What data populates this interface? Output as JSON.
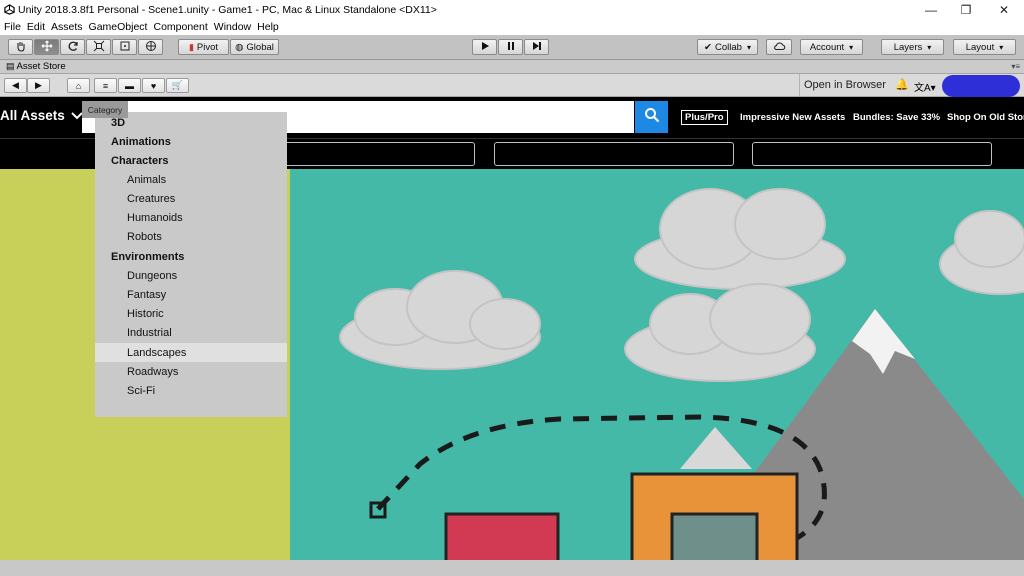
{
  "window": {
    "title": "Unity 2018.3.8f1 Personal - Scene1.unity - Game1 - PC, Mac & Linux Standalone <DX11>",
    "minimize": "—",
    "restore": "❐",
    "close": "✕"
  },
  "menu": [
    "File",
    "Edit",
    "Assets",
    "GameObject",
    "Component",
    "Window",
    "Help"
  ],
  "toolbar": {
    "pivot": "Pivot",
    "global": "Global",
    "collab": "Collab",
    "account": "Account",
    "layers": "Layers",
    "layout": "Layout"
  },
  "panel": {
    "title": "Asset Store",
    "menu_glyph": "▾≡"
  },
  "nav": {
    "open_in_browser": "Open in Browser"
  },
  "tooltip": "Category",
  "store": {
    "all_assets": "All Assets",
    "plus_pro": "Plus/Pro",
    "links": [
      "Impressive New Assets",
      "Bundles: Save 33%",
      "Shop On Old Store"
    ]
  },
  "dropdown": {
    "items": [
      {
        "label": "3D",
        "kind": "group"
      },
      {
        "label": "Animations",
        "kind": "group"
      },
      {
        "label": "Characters",
        "kind": "group"
      },
      {
        "label": "Animals",
        "kind": "sub"
      },
      {
        "label": "Creatures",
        "kind": "sub"
      },
      {
        "label": "Humanoids",
        "kind": "sub"
      },
      {
        "label": "Robots",
        "kind": "sub"
      },
      {
        "label": "Environments",
        "kind": "group"
      },
      {
        "label": "Dungeons",
        "kind": "sub"
      },
      {
        "label": "Fantasy",
        "kind": "sub"
      },
      {
        "label": "Historic",
        "kind": "sub"
      },
      {
        "label": "Industrial",
        "kind": "sub"
      },
      {
        "label": "Landscapes",
        "kind": "sub"
      },
      {
        "label": "Roadways",
        "kind": "sub"
      },
      {
        "label": "Sci-Fi",
        "kind": "sub"
      }
    ],
    "highlighted": "Landscapes"
  },
  "colors": {
    "search_button": "#1e88e5",
    "hero_sky": "#44b9a8",
    "hero_left": "#c9d05a"
  }
}
